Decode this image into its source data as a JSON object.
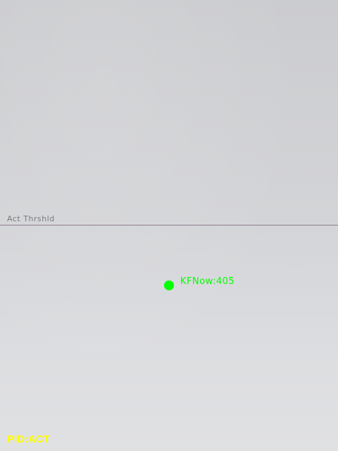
{
  "overlay": {
    "threshold": {
      "label": "Act Thrshld",
      "label_color": "#7b7b80",
      "line_color": "#8e7b8f"
    },
    "keyframe": {
      "label": "KFNow:405",
      "color": "#00ff00"
    },
    "pid_status": {
      "label": "PID:ACT",
      "color": "#ffff00"
    }
  },
  "icons": {
    "keyframe_marker": "filled-circle-icon"
  }
}
